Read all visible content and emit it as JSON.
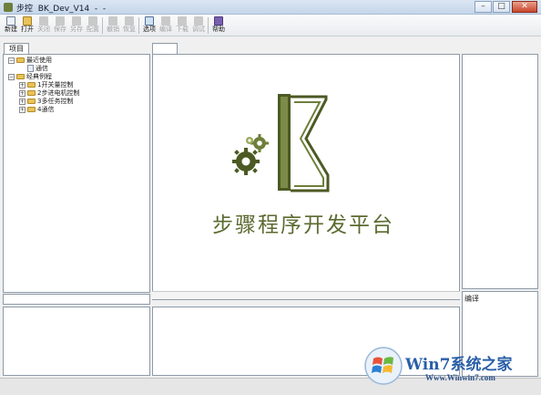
{
  "titlebar": {
    "title": "步控  BK_Dev_V14  -  -",
    "minimize_glyph": "–",
    "maximize_glyph": "□",
    "close_glyph": "✕"
  },
  "toolbar": {
    "buttons": [
      {
        "label": "新建",
        "icon": "new-file-icon",
        "enabled": true
      },
      {
        "label": "打开",
        "icon": "open-folder-icon",
        "enabled": true
      },
      {
        "label": "关闭",
        "icon": "close-file-icon",
        "enabled": false
      },
      {
        "label": "保存",
        "icon": "save-icon",
        "enabled": false
      },
      {
        "label": "另存",
        "icon": "save-as-icon",
        "enabled": false
      },
      {
        "label": "配置",
        "icon": "wrench-icon",
        "enabled": false
      },
      {
        "label": "撤销",
        "icon": "undo-icon",
        "enabled": false
      },
      {
        "label": "恢复",
        "icon": "redo-icon",
        "enabled": false
      },
      {
        "label": "选项",
        "icon": "options-icon",
        "enabled": true
      },
      {
        "label": "编译",
        "icon": "compile-icon",
        "enabled": false
      },
      {
        "label": "下载",
        "icon": "download-icon",
        "enabled": false
      },
      {
        "label": "调试",
        "icon": "debug-icon",
        "enabled": false
      },
      {
        "label": "帮助",
        "icon": "help-icon",
        "enabled": true
      }
    ]
  },
  "left_panel": {
    "tab_label": "项目",
    "tree": {
      "recent": {
        "label": "最近使用",
        "expander": "−",
        "children": [
          {
            "label": "通信"
          }
        ]
      },
      "examples": {
        "label": "经典例程",
        "expander": "−",
        "children": [
          {
            "label": "1开关量控制",
            "expander": "+"
          },
          {
            "label": "2步进电机控制",
            "expander": "+"
          },
          {
            "label": "3多任务控制",
            "expander": "+"
          },
          {
            "label": "4通信",
            "expander": "+"
          }
        ]
      }
    }
  },
  "splash": {
    "title": "步骤程序开发平台",
    "logo_colors": {
      "dark": "#4b5a22",
      "mid": "#6d7f3a",
      "light": "#9aab5e"
    }
  },
  "right_panel": {
    "compile_label": "编译"
  },
  "watermark": {
    "title": "Win7系统之家",
    "url": "Www.Winwin7.com"
  },
  "colors": {
    "accent_olive": "#5b6a30",
    "window_chrome": "#c5d6ea",
    "watermark_blue": "#2a5fa8"
  }
}
